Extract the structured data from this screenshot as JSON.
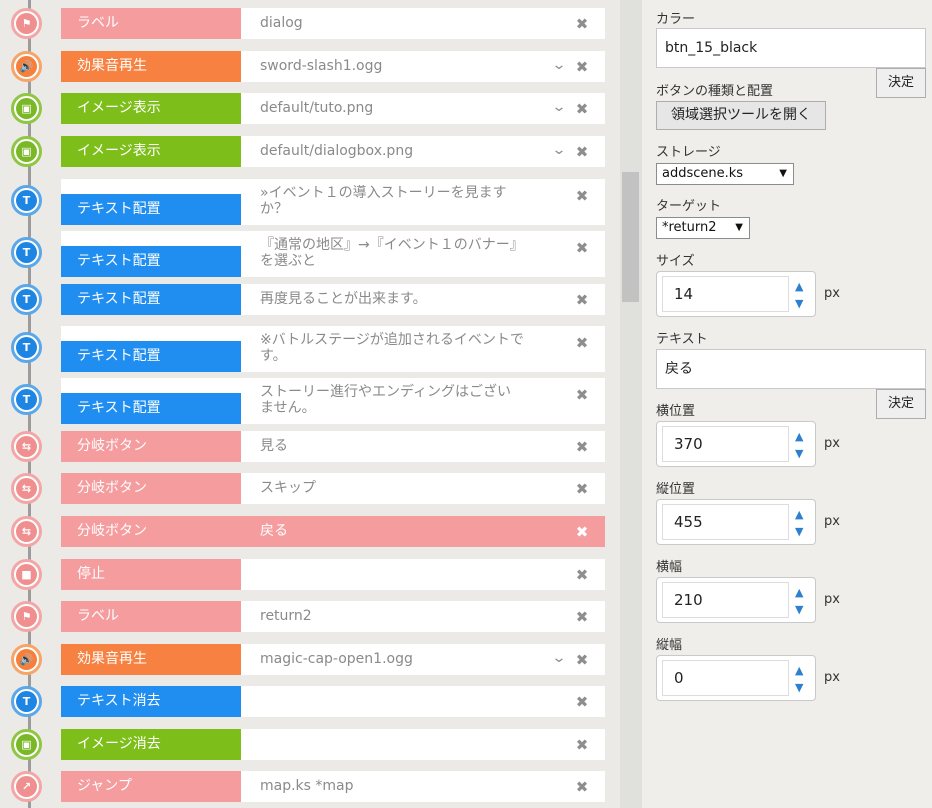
{
  "timeline": {
    "rows": [
      {
        "cat": "pink",
        "icon": "flag-icon",
        "glyph": "⚑",
        "tag": "ラベル",
        "value": "dialog",
        "chevron": false,
        "active": false
      },
      {
        "cat": "orange",
        "icon": "speaker-icon",
        "glyph": "🔊",
        "tag": "効果音再生",
        "value": "sword-slash1.ogg",
        "chevron": true,
        "active": false
      },
      {
        "cat": "green",
        "icon": "image-icon",
        "glyph": "▣",
        "tag": "イメージ表示",
        "value": "default/tuto.png",
        "chevron": true,
        "active": false
      },
      {
        "cat": "green",
        "icon": "image-icon",
        "glyph": "▣",
        "tag": "イメージ表示",
        "value": "default/dialogbox.png",
        "chevron": true,
        "active": false
      },
      {
        "cat": "blue",
        "icon": "text-icon",
        "glyph": "T",
        "tag": "テキスト配置",
        "value": "»イベント１の導入ストーリーを見ますか？",
        "chevron": false,
        "active": false,
        "multi": true
      },
      {
        "cat": "blue",
        "icon": "text-icon",
        "glyph": "T",
        "tag": "テキスト配置",
        "value": "『通常の地区』→『イベント１のバナー』を選ぶと",
        "chevron": false,
        "active": false,
        "multi": true
      },
      {
        "cat": "blue",
        "icon": "text-icon",
        "glyph": "T",
        "tag": "テキスト配置",
        "value": "再度見ることが出来ます。",
        "chevron": false,
        "active": false
      },
      {
        "cat": "blue",
        "icon": "text-icon",
        "glyph": "T",
        "tag": "テキスト配置",
        "value": "※バトルステージが追加されるイベントです。",
        "chevron": false,
        "active": false,
        "multi": true
      },
      {
        "cat": "blue",
        "icon": "text-icon",
        "glyph": "T",
        "tag": "テキスト配置",
        "value": "ストーリー進行やエンディングはございません。",
        "chevron": false,
        "active": false,
        "multi": true
      },
      {
        "cat": "pink",
        "icon": "branch-icon",
        "glyph": "⇆",
        "tag": "分岐ボタン",
        "value": "見る",
        "chevron": false,
        "active": false
      },
      {
        "cat": "pink",
        "icon": "branch-icon",
        "glyph": "⇆",
        "tag": "分岐ボタン",
        "value": "スキップ",
        "chevron": false,
        "active": false
      },
      {
        "cat": "pink",
        "icon": "branch-icon",
        "glyph": "⇆",
        "tag": "分岐ボタン",
        "value": "戻る",
        "chevron": false,
        "active": true
      },
      {
        "cat": "pink",
        "icon": "stop-icon",
        "glyph": "■",
        "tag": "停止",
        "value": "",
        "chevron": false,
        "active": false
      },
      {
        "cat": "pink",
        "icon": "flag-icon",
        "glyph": "⚑",
        "tag": "ラベル",
        "value": "return2",
        "chevron": false,
        "active": false
      },
      {
        "cat": "orange",
        "icon": "speaker-icon",
        "glyph": "🔊",
        "tag": "効果音再生",
        "value": "magic-cap-open1.ogg",
        "chevron": true,
        "active": false
      },
      {
        "cat": "blue",
        "icon": "text-icon",
        "glyph": "T",
        "tag": "テキスト消去",
        "value": "",
        "chevron": false,
        "active": false
      },
      {
        "cat": "green",
        "icon": "image-icon",
        "glyph": "▣",
        "tag": "イメージ消去",
        "value": "",
        "chevron": false,
        "active": false
      },
      {
        "cat": "pink",
        "icon": "jump-icon",
        "glyph": "↗",
        "tag": "ジャンプ",
        "value": "map.ks *map",
        "chevron": false,
        "active": false
      }
    ],
    "delete_glyph": "✖",
    "chevron_glyph": "⌄"
  },
  "props": {
    "color_label": "カラー",
    "color_value": "btn_15_black",
    "ok_label": "決定",
    "button_type_label": "ボタンの種類と配置",
    "open_tool_label": "領域選択ツールを開く",
    "storage_label": "ストレージ",
    "storage_value": "addscene.ks",
    "target_label": "ターゲット",
    "target_value": "*return2",
    "size_label": "サイズ",
    "size_value": "14",
    "text_label": "テキスト",
    "text_value": "戻る",
    "x_label": "横位置",
    "x_value": "370",
    "y_label": "縦位置",
    "y_value": "455",
    "width_label": "横幅",
    "width_value": "210",
    "height_label": "縦幅",
    "height_value": "0",
    "unit": "px",
    "up_glyph": "▲",
    "down_glyph": "▼",
    "dropdown_glyph": "▼"
  },
  "colors": {
    "pink": "#f59c9f",
    "orange": "#f68141",
    "green": "#7dbe1b",
    "blue": "#1f8ef0"
  }
}
